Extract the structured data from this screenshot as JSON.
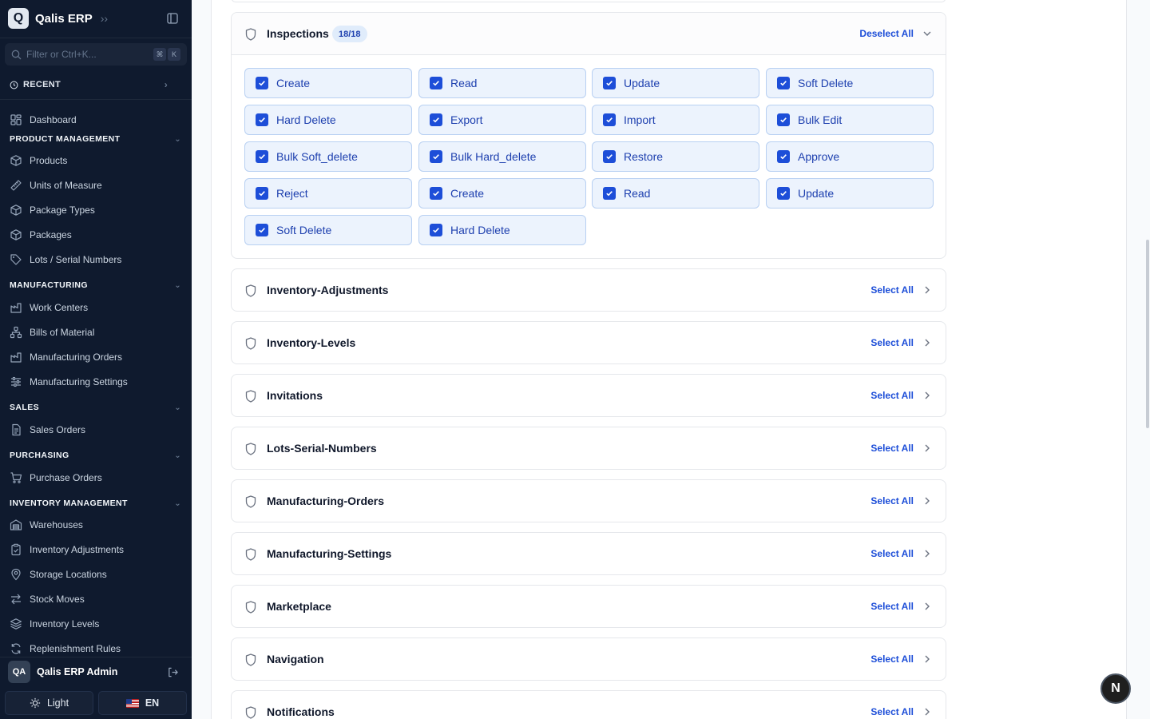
{
  "app": {
    "logo_letter": "Q",
    "name": "Qalis ERP"
  },
  "filter": {
    "placeholder": "Filter or Ctrl+K...",
    "kbd_1": "⌘",
    "kbd_2": "K"
  },
  "recent": {
    "label": "RECENT"
  },
  "nav": {
    "dashboard": "Dashboard",
    "sections": [
      {
        "title": "PRODUCT MANAGEMENT",
        "items": [
          "Products",
          "Units of Measure",
          "Package Types",
          "Packages",
          "Lots / Serial Numbers"
        ]
      },
      {
        "title": "MANUFACTURING",
        "items": [
          "Work Centers",
          "Bills of Material",
          "Manufacturing Orders",
          "Manufacturing Settings"
        ]
      },
      {
        "title": "SALES",
        "items": [
          "Sales Orders"
        ]
      },
      {
        "title": "PURCHASING",
        "items": [
          "Purchase Orders"
        ]
      },
      {
        "title": "INVENTORY MANAGEMENT",
        "items": [
          "Warehouses",
          "Inventory Adjustments",
          "Storage Locations",
          "Stock Moves",
          "Inventory Levels",
          "Replenishment Rules"
        ]
      }
    ]
  },
  "user": {
    "initials": "QA",
    "name": "Qalis ERP Admin"
  },
  "footer": {
    "theme_label": "Light",
    "lang_label": "EN"
  },
  "inspections": {
    "title": "Inspections",
    "count": "18/18",
    "action": "Deselect All",
    "permissions": [
      "Create",
      "Read",
      "Update",
      "Soft Delete",
      "Hard Delete",
      "Export",
      "Import",
      "Bulk Edit",
      "Bulk Soft_delete",
      "Bulk Hard_delete",
      "Restore",
      "Approve",
      "Reject",
      "Create",
      "Read",
      "Update",
      "Soft Delete",
      "Hard Delete"
    ]
  },
  "modules": [
    {
      "title": "Inventory-Adjustments",
      "action": "Select All"
    },
    {
      "title": "Inventory-Levels",
      "action": "Select All"
    },
    {
      "title": "Invitations",
      "action": "Select All"
    },
    {
      "title": "Lots-Serial-Numbers",
      "action": "Select All"
    },
    {
      "title": "Manufacturing-Orders",
      "action": "Select All"
    },
    {
      "title": "Manufacturing-Settings",
      "action": "Select All"
    },
    {
      "title": "Marketplace",
      "action": "Select All"
    },
    {
      "title": "Navigation",
      "action": "Select All"
    },
    {
      "title": "Notifications",
      "action": "Select All"
    }
  ],
  "fab": {
    "label": "N"
  },
  "colors": {
    "sidebar_bg": "#0f1a2e",
    "accent": "#1d4ed8",
    "permission_bg": "#ecf3fd"
  }
}
